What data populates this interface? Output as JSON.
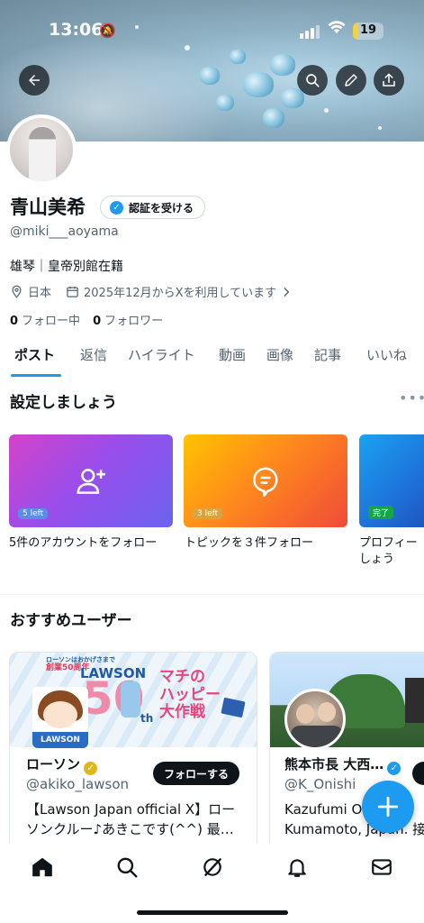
{
  "status_bar": {
    "time": "13:06",
    "battery": "19",
    "battery_level": 0.19
  },
  "profile": {
    "name": "青山美希",
    "verify_label": "認証を受ける",
    "handle": "@miki___aoyama",
    "bio": "雄琴｜皇帝別館在籍",
    "location": "日本",
    "joined": "2025年12月からXを利用しています",
    "following_count": "0",
    "following_label": "フォロー中",
    "followers_count": "0",
    "followers_label": "フォロワー"
  },
  "tabs": [
    "ポスト",
    "返信",
    "ハイライト",
    "動画",
    "画像",
    "記事",
    "いいね"
  ],
  "setup": {
    "title": "設定しましょう",
    "cards": [
      {
        "badge": "5 left",
        "label": "5件のアカウントをフォロー",
        "icon": "add-user-icon"
      },
      {
        "badge": "3 left",
        "label": "トピックを３件フォロー",
        "icon": "topic-icon"
      },
      {
        "badge": "完了",
        "label": "プロフィー",
        "label2": "しょう",
        "icon": "profile-icon"
      }
    ]
  },
  "recommended": {
    "title": "おすすめユーザー",
    "users": [
      {
        "name": "ローソン",
        "handle": "@akiko_lawson",
        "follow_label": "フォローする",
        "desc_line1": "【Lawson Japan official X】ロー",
        "desc_line2": "ソンクルー♪あきこです(^^) 最…",
        "banner_brand": "LAWSON",
        "banner_big": "50",
        "banner_th": "th",
        "banner_slogan1": "マチの",
        "banner_slogan2": "ハッピー",
        "banner_slogan3": "大作戦",
        "banner_small1": "ローソンはおかげさまで",
        "banner_small2": "創業50周年",
        "avatar_text": "LAWSON"
      },
      {
        "name": "熊本市長 大西…",
        "handle": "@K_Onishi",
        "desc_line1": "Kazufumi O",
        "desc_line2": "Kumamoto, Japan. 接"
      }
    ]
  },
  "colors": {
    "accent": "#1d9bf0",
    "text": "#0f1419",
    "muted": "#536471",
    "verified_gold": "#e2b719"
  }
}
